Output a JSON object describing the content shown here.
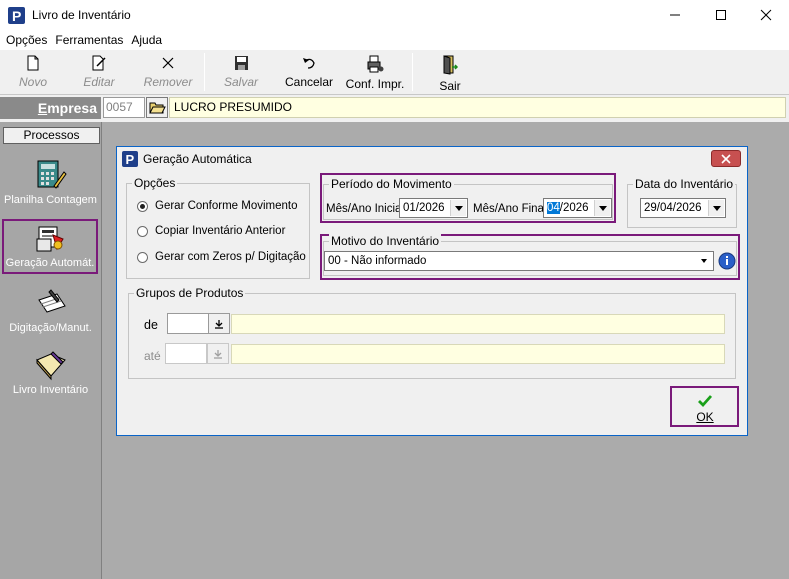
{
  "window": {
    "title": "Livro de Inventário"
  },
  "menu": [
    "Opções",
    "Ferramentas",
    "Ajuda"
  ],
  "toolbar": {
    "novo": "Novo",
    "editar": "Editar",
    "remover": "Remover",
    "salvar": "Salvar",
    "cancelar": "Cancelar",
    "conf_impr": "Conf. Impr.",
    "sair": "Sair"
  },
  "empresa": {
    "label_prefix": "E",
    "label_rest": "mpresa",
    "code": "0057",
    "name": "LUCRO PRESUMIDO"
  },
  "sidebar": {
    "header": "Processos",
    "items": [
      "Planilha Contagem",
      "Geração Automát.",
      "Digitação/Manut.",
      "Livro Inventário"
    ]
  },
  "dialog": {
    "title": "Geração Automática",
    "opcoes": {
      "title": "Opções",
      "options": [
        "Gerar Conforme Movimento",
        "Copiar Inventário Anterior",
        "Gerar com Zeros p/ Digitação"
      ],
      "selected_index": 0
    },
    "periodo": {
      "title": "Período do Movimento",
      "inicial_label": "Mês/Ano Inicial",
      "inicial_value": "01/2026",
      "final_label": "Mês/Ano Final",
      "final_value_selected": "04",
      "final_value_rest": "/2026"
    },
    "data_inventario": {
      "title": "Data do Inventário",
      "value": "29/04/2026"
    },
    "motivo": {
      "title": "Motivo do Inventário",
      "value": "00 - Não informado"
    },
    "grupos": {
      "title": "Grupos de Produtos",
      "de_label": "de",
      "ate_label": "até"
    },
    "ok_label": "OK"
  },
  "colors": {
    "accent": "#0078d7",
    "highlight": "#7a1a7a",
    "yellow_field": "#ffffe1"
  }
}
